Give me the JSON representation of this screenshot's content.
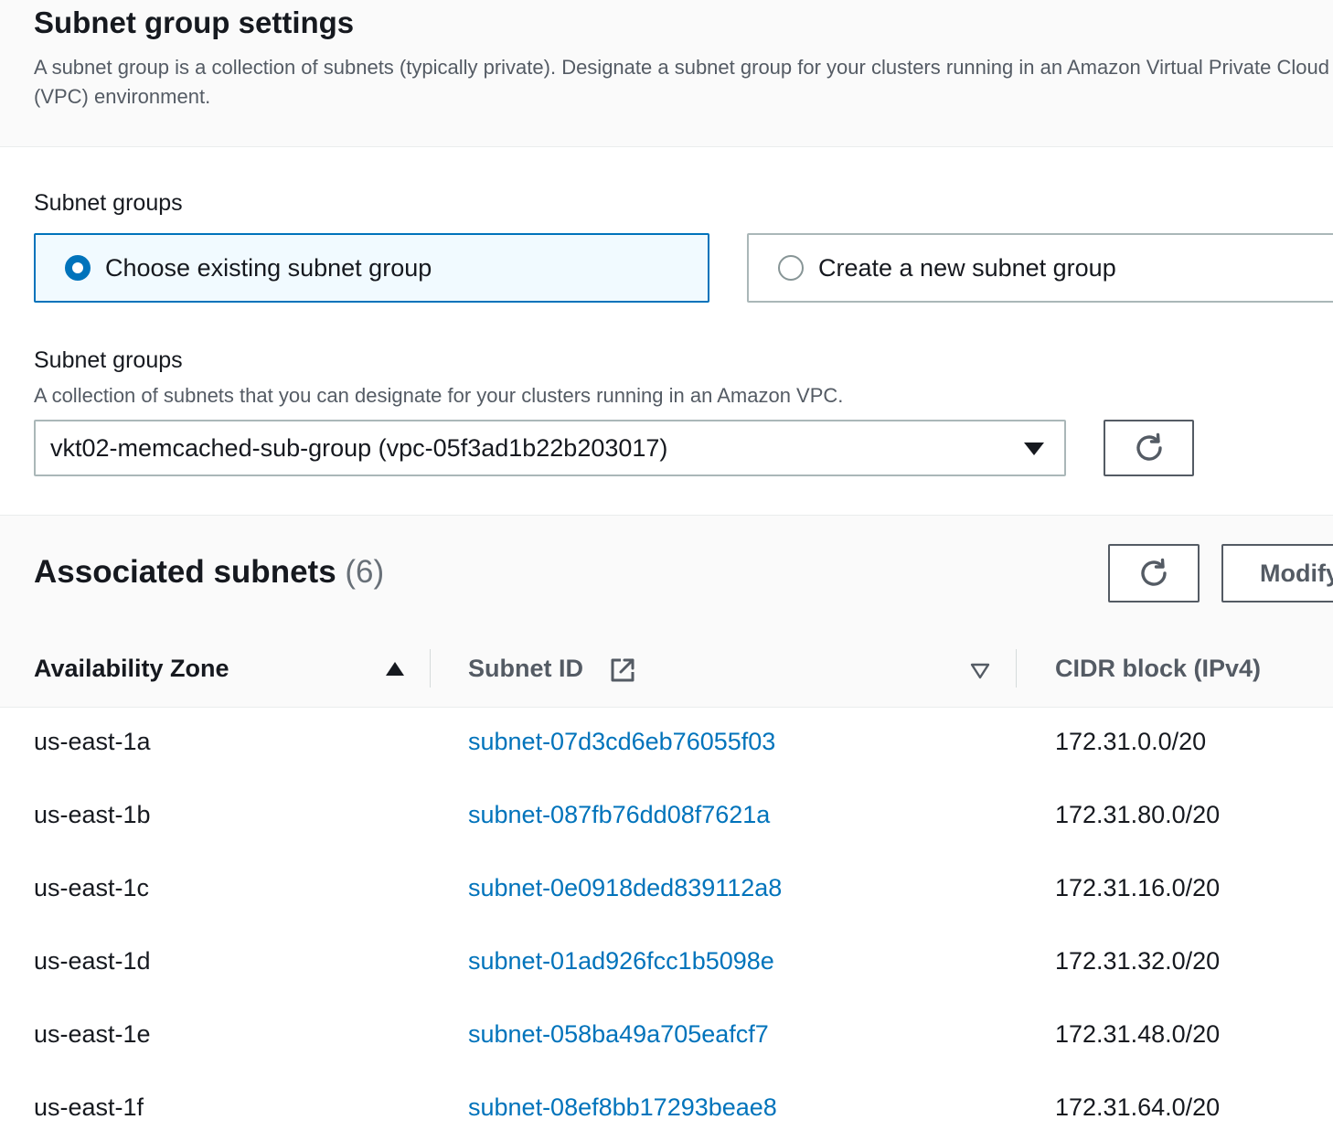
{
  "header": {
    "title": "Subnet group settings",
    "description": "A subnet group is a collection of subnets (typically private). Designate a subnet group for your clusters running in an Amazon Virtual Private Cloud (VPC) environment."
  },
  "subnet_groups_choice": {
    "label": "Subnet groups",
    "options": [
      {
        "label": "Choose existing subnet group",
        "selected": true
      },
      {
        "label": "Create a new subnet group",
        "selected": false
      }
    ]
  },
  "subnet_group_select": {
    "label": "Subnet groups",
    "description": "A collection of subnets that you can designate for your clusters running in an Amazon VPC.",
    "value": "vkt02-memcached-sub-group (vpc-05f3ad1b22b203017)"
  },
  "associated_subnets": {
    "title": "Associated subnets",
    "count": "(6)",
    "modify_label": "Modify",
    "columns": [
      {
        "label": "Availability Zone",
        "sort": "ascending"
      },
      {
        "label": "Subnet ID",
        "sort": "none"
      },
      {
        "label": "CIDR block (IPv4)"
      }
    ],
    "rows": [
      {
        "az": "us-east-1a",
        "subnet_id": "subnet-07d3cd6eb76055f03",
        "cidr": "172.31.0.0/20"
      },
      {
        "az": "us-east-1b",
        "subnet_id": "subnet-087fb76dd08f7621a",
        "cidr": "172.31.80.0/20"
      },
      {
        "az": "us-east-1c",
        "subnet_id": "subnet-0e0918ded839112a8",
        "cidr": "172.31.16.0/20"
      },
      {
        "az": "us-east-1d",
        "subnet_id": "subnet-01ad926fcc1b5098e",
        "cidr": "172.31.32.0/20"
      },
      {
        "az": "us-east-1e",
        "subnet_id": "subnet-058ba49a705eafcf7",
        "cidr": "172.31.48.0/20"
      },
      {
        "az": "us-east-1f",
        "subnet_id": "subnet-08ef8bb17293beae8",
        "cidr": "172.31.64.0/20"
      }
    ]
  },
  "icons": {
    "refresh": "refresh-icon",
    "external_link": "external-link-icon",
    "caret_down": "caret-down-icon",
    "sort_ascending": "sort-ascending-icon",
    "sort_descending": "sort-descending-icon"
  },
  "colors": {
    "accent": "#0073bb",
    "text": "#16191f",
    "muted_text": "#545b64",
    "selected_tile_bg": "#f1faff"
  }
}
